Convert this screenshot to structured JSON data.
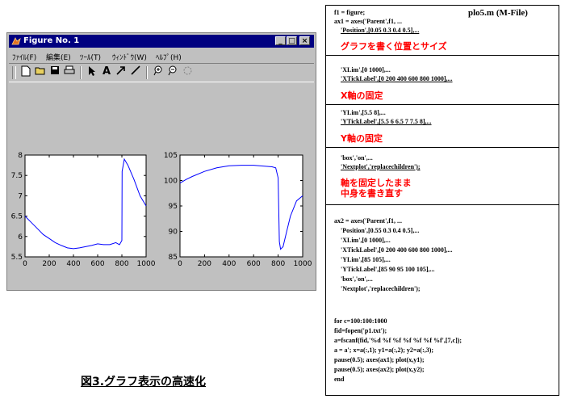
{
  "window": {
    "title": "Figure No. 1",
    "menu": [
      "ﾌｧｲﾙ(F)",
      "編集(E)",
      "ﾂｰﾙ(T)",
      "ｳｨﾝﾄﾞｳ(W)",
      "ﾍﾙﾌﾟ(H)"
    ],
    "toolbar_icons": [
      "new-file-icon",
      "open-folder-icon",
      "save-icon",
      "print-icon",
      "arrow-select-icon",
      "text-icon",
      "arrow-icon",
      "line-icon",
      "zoom-in-icon",
      "zoom-out-icon",
      "rotate-icon"
    ],
    "controls": {
      "minimize": "_",
      "maximize": "□",
      "close": "×"
    }
  },
  "code": {
    "file_label": "plo5.m  (M-File)",
    "lines": {
      "l1": "f1 = figure;",
      "l2": "ax1 = axes('Parent',f1, ...",
      "l3": "'Position',[0.05 0.3 0.4 0.5],...",
      "n1": "グラフを書く位置とサイズ",
      "l4": "'XLim',[0 1000],...",
      "l5": "'XTickLabel',[0 200 400 600 800 1000],...",
      "n2": "X軸の固定",
      "l6": "'YLim',[5.5 8],...",
      "l7": "'YTickLabel',[5.5 6 6.5 7 7.5 8],...",
      "n3": "Y軸の固定",
      "l8": "'box','on',...",
      "l9": "'Nextplot','replacechildren');",
      "n4a": "軸を固定したまま",
      "n4b": "中身を書き直す",
      "m1": "ax2 = axes('Parent',f1, ...",
      "m2": "'Position',[0.55 0.3 0.4 0.5],...",
      "m3": "'XLim',[0 1000],...",
      "m4": "'XTickLabel',[0 200 400 600 800 1000],...",
      "m5": "'YLim',[85 105],...",
      "m6": "'YTickLabel',[85 90 95 100 105],...",
      "m7": "'box','on',...",
      "m8": "'Nextplot','replacechildren');",
      "f1": "for c=100:100:1000",
      "f2": "fid=fopen('p1.txt');",
      "f3": "a=fscanf(fid,'%d %f %f %f %f %f %f',[7,c]);",
      "f4": "a = a'; x=a(:,1); y1=a(:,2); y2=a(:,3);",
      "f5": "pause(0.5); axes(ax1); plot(x,y1);",
      "f6": "pause(0.5); axes(ax2); plot(x,y2);",
      "f7": "end"
    }
  },
  "caption": "図3.グラフ表示の高速化",
  "chart_data": [
    {
      "type": "line",
      "xlim": [
        0,
        1000
      ],
      "ylim": [
        5.5,
        8
      ],
      "xticks": [
        0,
        200,
        400,
        600,
        800,
        1000
      ],
      "yticks": [
        5.5,
        6,
        6.5,
        7,
        7.5,
        8
      ],
      "ytick_labels": [
        "5.5",
        "6",
        "6.5",
        "7",
        "7.5",
        "8"
      ],
      "color": "#0000ff",
      "x": [
        0,
        50,
        100,
        150,
        200,
        250,
        300,
        350,
        400,
        450,
        500,
        550,
        600,
        650,
        700,
        750,
        780,
        800,
        802,
        820,
        850,
        900,
        950,
        1000
      ],
      "y": [
        6.5,
        6.35,
        6.2,
        6.05,
        5.95,
        5.85,
        5.78,
        5.72,
        5.7,
        5.72,
        5.75,
        5.78,
        5.82,
        5.8,
        5.8,
        5.85,
        5.8,
        5.9,
        7.6,
        7.9,
        7.75,
        7.4,
        7.0,
        6.75
      ]
    },
    {
      "type": "line",
      "xlim": [
        0,
        1000
      ],
      "ylim": [
        85,
        105
      ],
      "xticks": [
        0,
        200,
        400,
        600,
        800,
        1000
      ],
      "yticks": [
        85,
        90,
        95,
        100,
        105
      ],
      "ytick_labels": [
        "85",
        "90",
        "95",
        "100",
        "105"
      ],
      "color": "#0000ff",
      "x": [
        0,
        50,
        100,
        200,
        300,
        400,
        500,
        600,
        700,
        750,
        780,
        800,
        810,
        820,
        840,
        870,
        900,
        950,
        1000
      ],
      "y": [
        99.5,
        100.2,
        100.8,
        101.8,
        102.5,
        102.9,
        103.0,
        103.0,
        102.8,
        102.7,
        102.5,
        100.5,
        88,
        86.5,
        87,
        90,
        93,
        96,
        97
      ]
    }
  ]
}
